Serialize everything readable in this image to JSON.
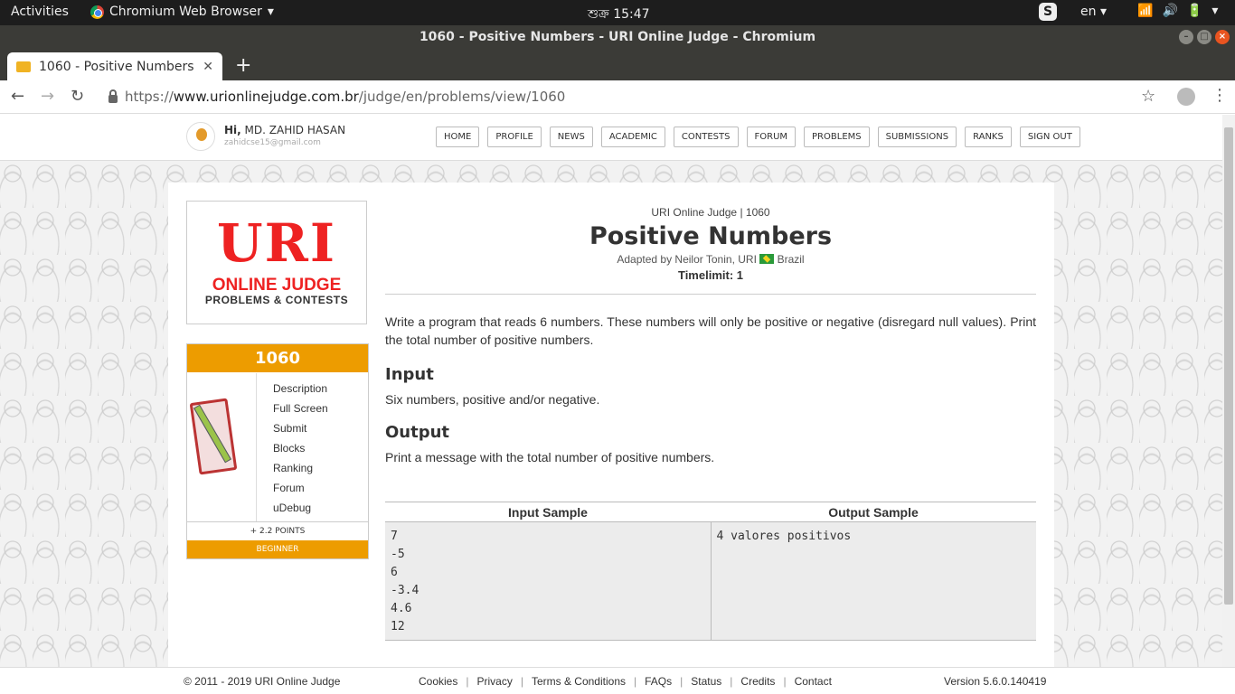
{
  "os": {
    "activities": "Activities",
    "app_name": "Chromium Web Browser",
    "clock": "শুক্র 15:47",
    "skype": "S",
    "language": "en"
  },
  "browser": {
    "window_title": "1060 - Positive Numbers - URI Online Judge - Chromium",
    "tab_title": "1060 - Positive Numbers - U",
    "url_prefix": "https://",
    "url_domain": "www.urionlinejudge.com.br",
    "url_path": "/judge/en/problems/view/1060"
  },
  "site": {
    "greeting_hi": "Hi,",
    "user_name": "MD. ZAHID HASAN",
    "user_email": "zahidcse15@gmail.com",
    "menu": [
      "HOME",
      "PROFILE",
      "NEWS",
      "ACADEMIC",
      "CONTESTS",
      "FORUM",
      "PROBLEMS",
      "SUBMISSIONS",
      "RANKS",
      "SIGN OUT"
    ]
  },
  "logo": {
    "uri": "URI",
    "online_judge": "ONLINE JUDGE",
    "problems_contests": "PROBLEMS & CONTESTS"
  },
  "problem_box": {
    "id": "1060",
    "links": [
      "Description",
      "Full Screen",
      "Submit",
      "Blocks",
      "Ranking",
      "Forum",
      "uDebug"
    ],
    "points": "+ 2.2 POINTS",
    "level": "BEGINNER"
  },
  "problem": {
    "breadcrumb": "URI Online Judge | 1060",
    "title": "Positive Numbers",
    "author_prefix": "Adapted by Neilor Tonin, URI",
    "author_country": "Brazil",
    "timelimit": "Timelimit: 1",
    "description": "Write a program that reads 6 numbers. These numbers will only be positive or negative (disregard null values). Print the total number of positive numbers.",
    "input_heading": "Input",
    "input_text": "Six numbers, positive and/or negative.",
    "output_heading": "Output",
    "output_text": "Print a message with the total number of positive numbers.",
    "input_sample_heading": "Input Sample",
    "output_sample_heading": "Output Sample",
    "input_sample_lines": [
      "7",
      "-5",
      "6",
      "-3.4",
      "4.6",
      "12"
    ],
    "output_sample_lines": [
      "4 valores positivos"
    ]
  },
  "footer": {
    "copyright": "© 2011 - 2019 URI Online Judge",
    "links": [
      "Cookies",
      "Privacy",
      "Terms & Conditions",
      "FAQs",
      "Status",
      "Credits",
      "Contact"
    ],
    "version": "Version 5.6.0.140419"
  },
  "colors": {
    "accent": "#ed9c00",
    "logo_red": "#e22222",
    "gnome_bar": "#1d1d1d"
  }
}
